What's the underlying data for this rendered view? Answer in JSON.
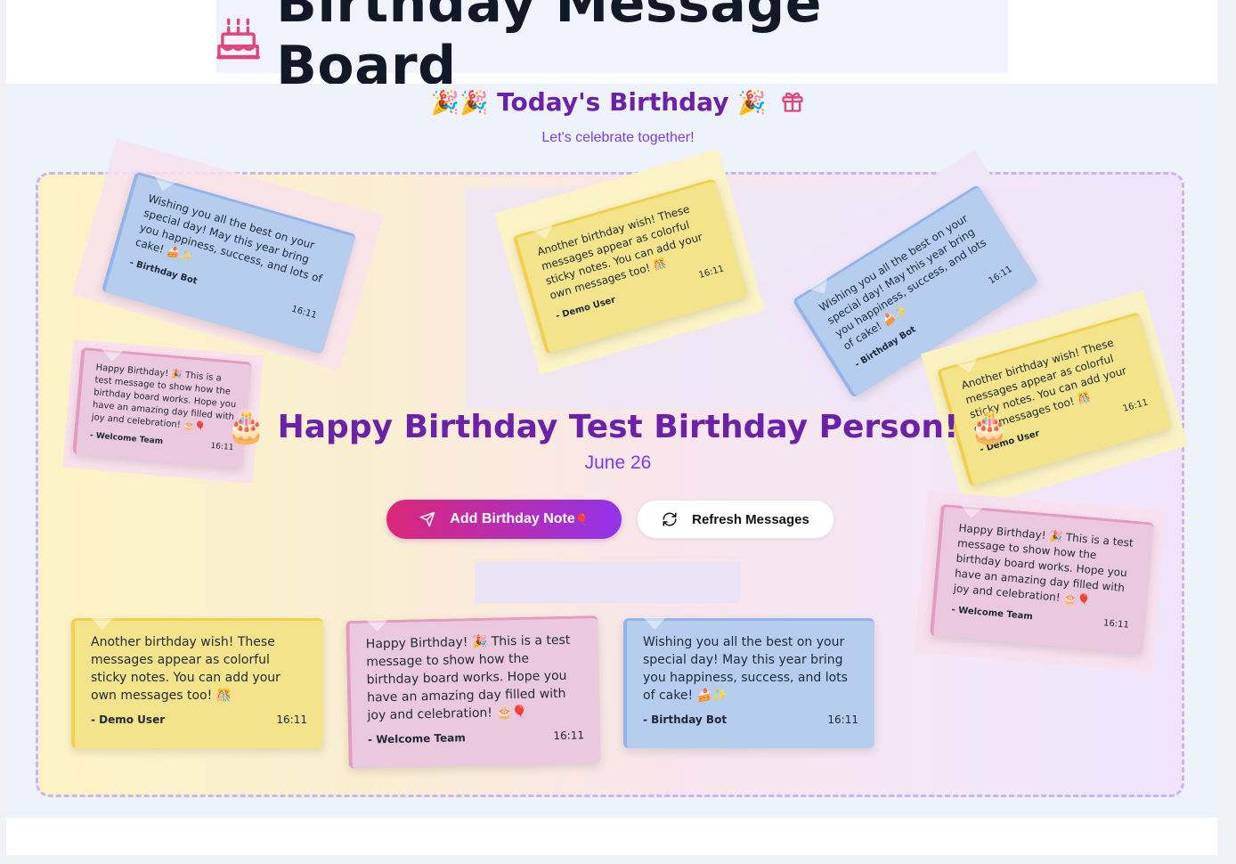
{
  "header": {
    "title": "Birthday Message Board",
    "cake_icon": "cake-icon"
  },
  "today": {
    "title": "Today's Birthday",
    "tagline": "Let's celebrate together!",
    "emoji_left": "🎉🎉",
    "emoji_right": "🎉",
    "gift_icon": "gift-icon"
  },
  "celebrant": {
    "greeting": "Happy Birthday Test Birthday Person!",
    "emoji": "🎂",
    "date": "June 26"
  },
  "actions": {
    "add_label": "Add Birthday Note",
    "add_emoji": "🎈",
    "refresh_label": "Refresh Messages"
  },
  "notes": [
    {
      "message": "Another birthday wish! These messages appear as colorful sticky notes. You can add your own messages too! 🎊",
      "author": "- Demo User",
      "time": "16:11",
      "color": "#f3e38a"
    },
    {
      "message": "Happy Birthday! 🎉 This is a test message to show how the birthday board works. Hope you have an amazing day filled with joy and celebration! 🎂🎈",
      "author": "- Welcome Team",
      "time": "16:11",
      "color": "#eac8de"
    },
    {
      "message": "Wishing you all the best on your special day! May this year bring you happiness, success, and lots of cake! 🍰✨",
      "author": "- Birthday Bot",
      "time": "16:11",
      "color": "#b6cdee"
    }
  ],
  "colors": {
    "accent_purple": "#6b21a8",
    "button_gradient_start": "#db2777",
    "button_gradient_end": "#9333ea",
    "board_border": "#c4b5fd"
  }
}
